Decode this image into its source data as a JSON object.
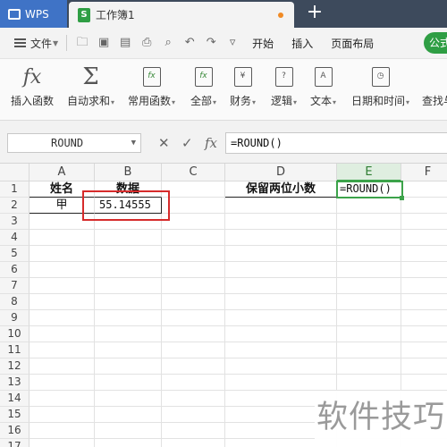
{
  "titlebar": {
    "app_tab": "WPS",
    "doc_tab": "工作簿1"
  },
  "menubar": {
    "file": "文件",
    "items": [
      "开始",
      "插入",
      "页面布局",
      "公式"
    ]
  },
  "ribbon": {
    "buttons": [
      {
        "label": "插入函数",
        "icon": "fx"
      },
      {
        "label": "自动求和",
        "icon": "Σ"
      },
      {
        "label": "常用函数",
        "icon": "fx"
      },
      {
        "label": "全部",
        "icon": "fx"
      },
      {
        "label": "财务",
        "icon": "¥"
      },
      {
        "label": "逻辑",
        "icon": "?"
      },
      {
        "label": "文本",
        "icon": "A"
      },
      {
        "label": "日期和时间",
        "icon": "◷"
      },
      {
        "label": "查找与",
        "icon": ""
      }
    ]
  },
  "formula_bar": {
    "name_box": "ROUND",
    "fx_label": "fx",
    "formula": "=ROUND()"
  },
  "grid": {
    "columns": [
      "A",
      "B",
      "C",
      "D",
      "E",
      "F"
    ],
    "rows": [
      "1",
      "2",
      "3",
      "4",
      "5",
      "6",
      "7",
      "8",
      "9",
      "10",
      "11",
      "12",
      "13",
      "14",
      "15",
      "16",
      "17"
    ],
    "cells": {
      "A1": "姓名",
      "B1": "数据",
      "D1": "保留两位小数",
      "E1": "=ROUND()",
      "A2": "甲",
      "B2": "55.14555"
    }
  },
  "watermark": "软件技巧",
  "colors": {
    "accent_green": "#3ca34a",
    "highlight_red": "#d62b2b",
    "wps_blue": "#3f73c6"
  }
}
